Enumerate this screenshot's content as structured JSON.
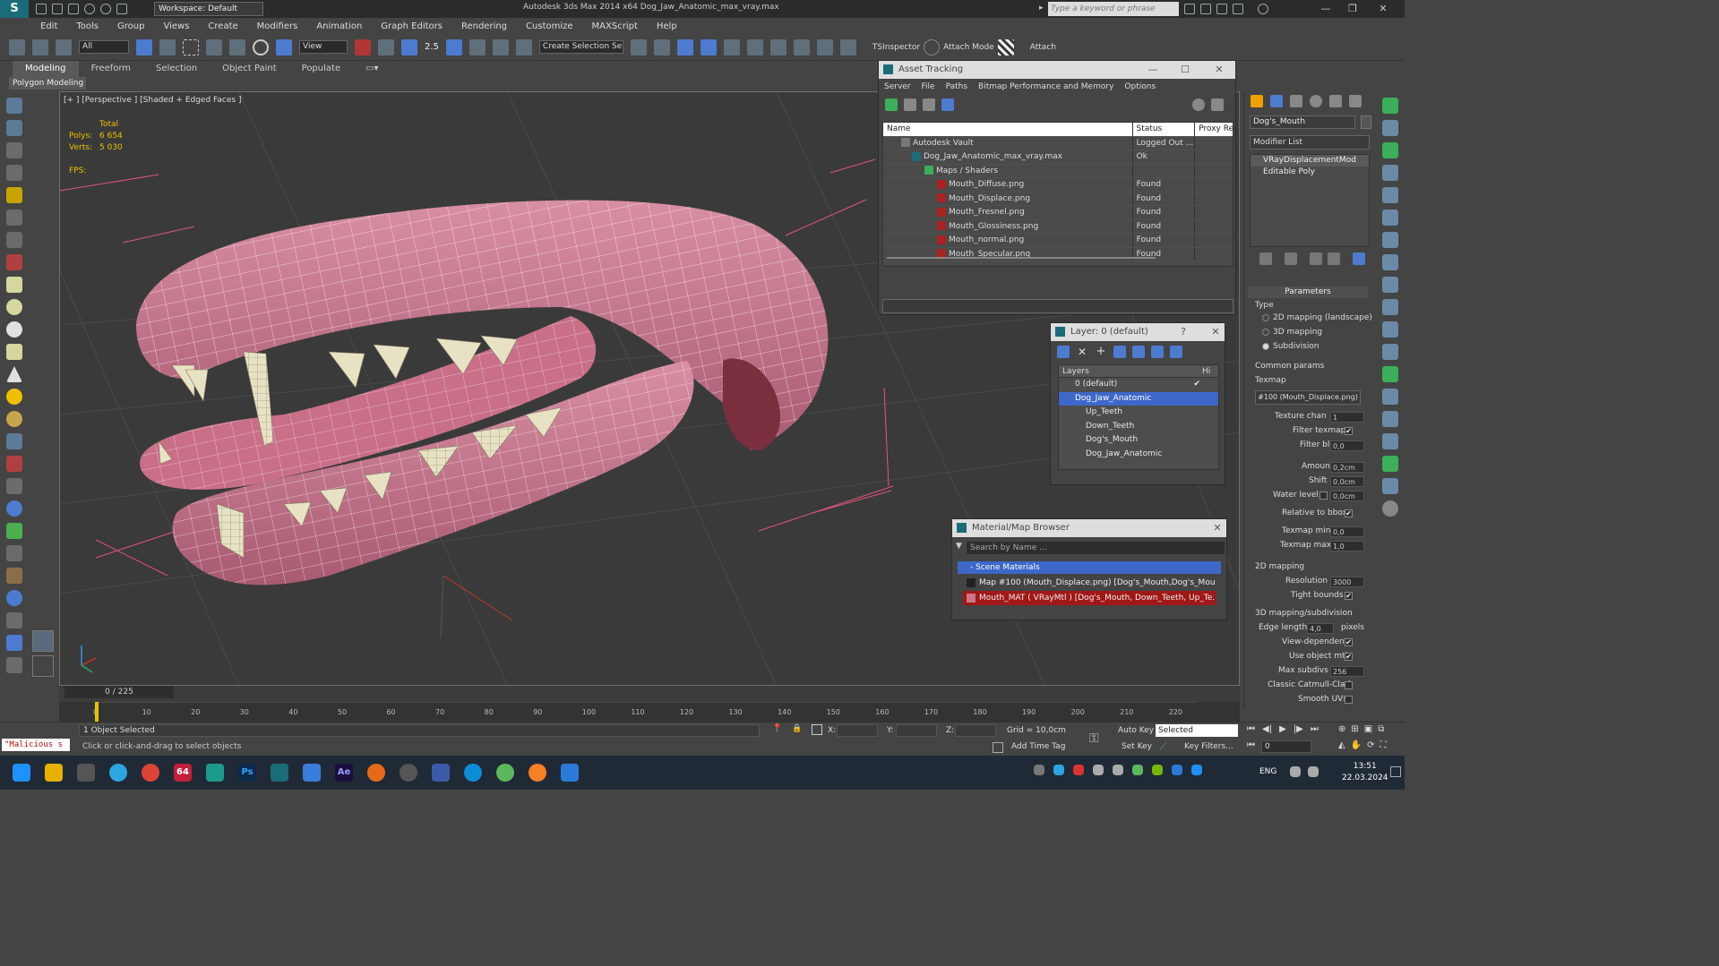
{
  "titlebar": {
    "workspace": "Workspace: Default",
    "app_title": "Autodesk 3ds Max  2014 x64     Dog_Jaw_Anatomic_max_vray.max",
    "search_placeholder": "Type a keyword or phrase"
  },
  "menu": [
    "Edit",
    "Tools",
    "Group",
    "Views",
    "Create",
    "Modifiers",
    "Animation",
    "Graph Editors",
    "Rendering",
    "Customize",
    "MAXScript",
    "Help"
  ],
  "toolbar": {
    "filter_value": "All",
    "view_value": "View",
    "snap_value": "2.5",
    "selection_set": "Create Selection Se",
    "tsinspector": "TSInspector",
    "attach_mode": "Attach Mode",
    "attach": "Attach"
  },
  "ribbon": {
    "tabs": [
      "Modeling",
      "Freeform",
      "Selection",
      "Object Paint",
      "Populate"
    ],
    "sublabel": "Polygon Modeling"
  },
  "viewport": {
    "label": "[+ ] [Perspective ] [Shaded + Edged Faces ]",
    "total": "Total",
    "polys_label": "Polys:",
    "polys_value": "6 654",
    "verts_label": "Verts:",
    "verts_value": "5 030",
    "fps_label": "FPS:"
  },
  "asset_tracking": {
    "title": "Asset Tracking",
    "menu": [
      "Server",
      "File",
      "Paths",
      "Bitmap Performance and Memory",
      "Options"
    ],
    "columns": [
      "Name",
      "Status",
      "Proxy Re"
    ],
    "rows": [
      {
        "name": "Autodesk Vault",
        "status": "Logged Out ..."
      },
      {
        "name": "Dog_Jaw_Anatomic_max_vray.max",
        "status": "Ok"
      },
      {
        "name": "Maps / Shaders",
        "status": ""
      },
      {
        "name": "Mouth_Diffuse.png",
        "status": "Found"
      },
      {
        "name": "Mouth_Displace.png",
        "status": "Found"
      },
      {
        "name": "Mouth_Fresnel.png",
        "status": "Found"
      },
      {
        "name": "Mouth_Glossiness.png",
        "status": "Found"
      },
      {
        "name": "Mouth_normal.png",
        "status": "Found"
      },
      {
        "name": "Mouth_Specular.png",
        "status": "Found"
      }
    ]
  },
  "layer_window": {
    "title": "Layer: 0 (default)",
    "help": "?",
    "col_layers": "Layers",
    "col_hide": "Hi",
    "items": [
      "0 (default)",
      "Dog_Jaw_Anatomic",
      "Up_Teeth",
      "Down_Teeth",
      "Dog's_Mouth",
      "Dog_Jaw_Anatomic"
    ]
  },
  "material_browser": {
    "title": "Material/Map Browser",
    "search_placeholder": "Search by Name ...",
    "section": "- Scene Materials",
    "items": [
      "Map #100 (Mouth_Displace.png) [Dog's_Mouth,Dog's_Mout...",
      "Mouth_MAT  ( VRayMtl )  [Dog's_Mouth, Down_Teeth, Up_Te..."
    ]
  },
  "command_panel": {
    "object_name": "Dog's_Mouth",
    "modifier_list": "Modifier List",
    "stack": [
      "VRayDisplacementMod",
      "Editable Poly"
    ],
    "parameters": "Parameters",
    "type_label": "Type",
    "type_options": [
      "2D mapping (landscape)",
      "3D mapping",
      "Subdivision"
    ],
    "common_params": "Common params",
    "texmap_label": "Texmap",
    "texmap_value": "#100 (Mouth_Displace.png)",
    "texture_chan_label": "Texture chan",
    "texture_chan_value": "1",
    "filter_texmap": "Filter texmap",
    "filter_blur_label": "Filter blur",
    "filter_blur_value": "0,0",
    "amount_label": "Amount",
    "amount_value": "0,2cm",
    "shift_label": "Shift",
    "shift_value": "0,0cm",
    "water_level_label": "Water level",
    "water_level_value": "0,0cm",
    "relative_bbox": "Relative to bbox",
    "texmap_min_label": "Texmap min",
    "texmap_min_value": "0,0",
    "texmap_max_label": "Texmap max",
    "texmap_max_value": "1,0",
    "mapping2d": "2D mapping",
    "resolution_label": "Resolution",
    "resolution_value": "3000",
    "tight_bounds": "Tight bounds",
    "mapping3d": "3D mapping/subdivision",
    "edge_length_label": "Edge length",
    "edge_length_value": "4,0",
    "pixels": "pixels",
    "view_dependent": "View-dependent",
    "use_object_mtl": "Use object mtl",
    "max_subdivs_label": "Max subdivs",
    "max_subdivs_value": "256",
    "classic_catmull": "Classic Catmull-Clark",
    "smooth_uvs": "Smooth UVs"
  },
  "timeline": {
    "slider": "0 / 225",
    "ticks": [
      "0",
      "10",
      "20",
      "30",
      "40",
      "50",
      "60",
      "70",
      "80",
      "90",
      "100",
      "110",
      "120",
      "130",
      "140",
      "150",
      "160",
      "170",
      "180",
      "190",
      "200",
      "210",
      "220"
    ]
  },
  "status": {
    "maxscript": "\"Malicious s",
    "selection": "1 Object Selected",
    "prompt": "Click or click-and-drag to select objects",
    "x_label": "X:",
    "y_label": "Y:",
    "z_label": "Z:",
    "grid": "Grid = 10,0cm",
    "add_time_tag": "Add Time Tag",
    "auto_key": "Auto Key",
    "set_key": "Set Key",
    "selected": "Selected",
    "key_filters": "Key Filters...",
    "frame": "0"
  },
  "taskbar": {
    "lang": "ENG",
    "time": "13:51",
    "date": "22.03.2024",
    "badge_64": "64",
    "ps": "Ps",
    "ae": "Ae"
  }
}
